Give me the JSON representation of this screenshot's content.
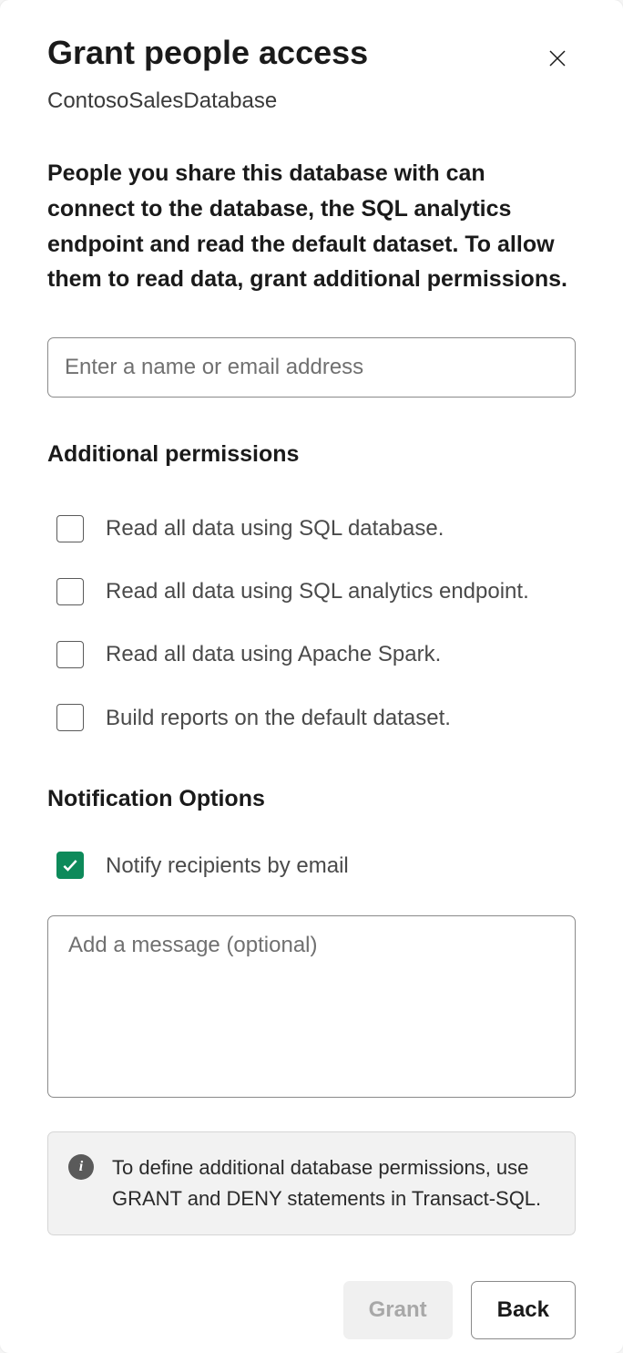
{
  "dialog": {
    "title": "Grant people access",
    "subtitle": "ContosoSalesDatabase",
    "description": "People you share this database with can connect to the database, the SQL analytics endpoint and read the default dataset. To allow them to read data, grant additional permissions.",
    "name_input_placeholder": "Enter a name or email address",
    "additional_permissions_heading": "Additional permissions",
    "permissions": [
      {
        "label": "Read all data using SQL database.",
        "checked": false
      },
      {
        "label": "Read all data using SQL analytics endpoint.",
        "checked": false
      },
      {
        "label": "Read all data using Apache Spark.",
        "checked": false
      },
      {
        "label": "Build reports on the default dataset.",
        "checked": false
      }
    ],
    "notification_heading": "Notification Options",
    "notify_label": "Notify recipients by email",
    "notify_checked": true,
    "message_placeholder": "Add a message (optional)",
    "info_text": "To define additional database permissions, use GRANT and DENY statements in Transact-SQL.",
    "grant_button": "Grant",
    "back_button": "Back"
  }
}
